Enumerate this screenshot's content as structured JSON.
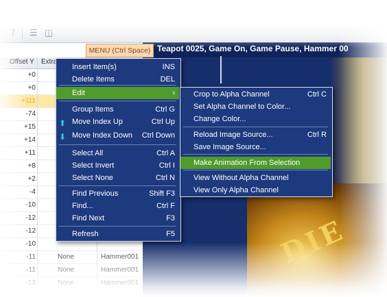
{
  "toolbar": {
    "icons": [
      "help-icon",
      "horizontal-split-icon",
      "vertical-split-icon"
    ]
  },
  "grid": {
    "headers": [
      "Offset Y",
      "Extra"
    ],
    "offsets": [
      "+0",
      "+0",
      "+111",
      "-74",
      "+15",
      "+14",
      "+11",
      "+8",
      "+2",
      "-4",
      "-10",
      "-12",
      "-12",
      "-10",
      "-11",
      "-11",
      "-13"
    ],
    "selected_offset_index": 2,
    "rows": [
      {
        "extra": "None",
        "name": "Hammer001"
      },
      {
        "extra": "None",
        "name": "Hammer001"
      },
      {
        "extra": "None",
        "name": "Hammer001"
      }
    ]
  },
  "canvas": {
    "menu_badge": "MENU (Ctrl Space)",
    "title": "Teapot 0025, Game On, Game Pause, Hammer 00"
  },
  "context_menu": {
    "items": [
      {
        "label": "Insert Item(s)",
        "shortcut": "INS"
      },
      {
        "label": "Delete Items",
        "shortcut": "DEL"
      },
      {
        "label": "Edit",
        "shortcut": "›"
      },
      {
        "label": "Group Items",
        "shortcut": "Ctrl G"
      },
      {
        "label": "Move Index Up",
        "shortcut": "Ctrl Up"
      },
      {
        "label": "Move Index Down",
        "shortcut": "Ctrl Down"
      },
      {
        "label": "Select All",
        "shortcut": "Ctrl A"
      },
      {
        "label": "Select Invert",
        "shortcut": "Ctrl I"
      },
      {
        "label": "Select None",
        "shortcut": "Ctrl N"
      },
      {
        "label": "Find Previous",
        "shortcut": "Shift F3"
      },
      {
        "label": "Find...",
        "shortcut": "Ctrl F"
      },
      {
        "label": "Find Next",
        "shortcut": "F3"
      },
      {
        "label": "Refresh",
        "shortcut": "F5"
      }
    ]
  },
  "edit_submenu": {
    "items": [
      {
        "label": "Crop to Alpha Channel",
        "shortcut": "Ctrl C"
      },
      {
        "label": "Set Alpha Channel to Color...",
        "shortcut": ""
      },
      {
        "label": "Change Color...",
        "shortcut": ""
      },
      {
        "label": "Reload Image Source...",
        "shortcut": "Ctrl R"
      },
      {
        "label": "Save Image Source...",
        "shortcut": ""
      },
      {
        "label": "Make Animation From Selection",
        "shortcut": ""
      },
      {
        "label": "View Without Alpha Channel",
        "shortcut": ""
      },
      {
        "label": "View Only Alpha Channel",
        "shortcut": ""
      }
    ]
  },
  "colors": {
    "menu_bg": "#1d3a7e",
    "highlight": "#4f9b2c",
    "badge_bg": "#f8d8b4",
    "selected_row": "#fde9a6"
  }
}
